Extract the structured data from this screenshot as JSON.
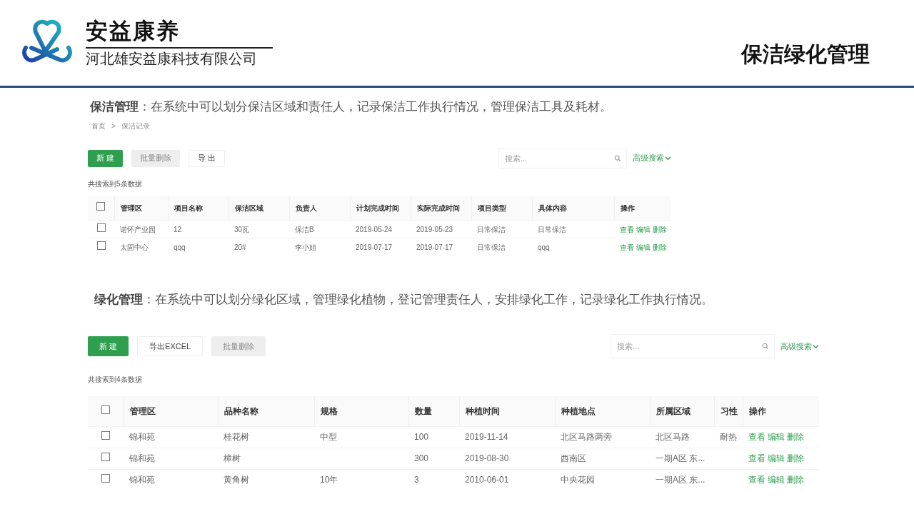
{
  "header": {
    "brand": "安益康养",
    "company": "河北雄安益康科技有限公司",
    "page_title": "保洁绿化管理"
  },
  "sections": [
    {
      "intro": "**保洁管理**：在系统中可以划分保洁区域和责任人，记录保洁工作执行情况，管理保洁工具及耗材。",
      "breadcrumb": [
        "首页",
        "保洁记录"
      ],
      "breadcrumb_sep": ">",
      "buttons": [
        {
          "label": "新 建",
          "kind": "primary",
          "disabled": false
        },
        {
          "label": "批量删除",
          "kind": "plain",
          "disabled": true
        },
        {
          "label": "导 出",
          "kind": "plain",
          "disabled": false
        }
      ],
      "search": {
        "placeholder": "搜索...",
        "advanced": "高级搜索"
      },
      "count": "共搜索到5条数据",
      "table": {
        "all_checked": false,
        "columns": [
          "管理区",
          "项目名称",
          "保洁区域",
          "负责人",
          "计划完成时间",
          "实际完成时间",
          "项目类型",
          "具体内容",
          "操作"
        ],
        "rows": [
          {
            "checked": false,
            "cells": [
              "诺怀产业园",
              "12",
              "30瓦",
              "保洁B",
              "2019-05-24",
              "2019-05-23",
              "日常保洁",
              "日常保洁"
            ],
            "actions": [
              "查看",
              "编辑",
              "删除"
            ]
          },
          {
            "checked": false,
            "cells": [
              "太固中心",
              "qqq",
              "20#",
              "李小姐",
              "2019-07-17",
              "2019-07-17",
              "日常保洁",
              "qqq"
            ],
            "actions": [
              "查看",
              "编辑",
              "删除"
            ]
          }
        ]
      }
    },
    {
      "intro": "**绿化管理**：在系统中可以划分绿化区域，管理绿化植物，登记管理责任人，安排绿化工作，记录绿化工作执行情况。",
      "buttons": [
        {
          "label": "新 建",
          "kind": "primary",
          "disabled": false
        },
        {
          "label": "导出EXCEL",
          "kind": "plain",
          "disabled": false
        },
        {
          "label": "批量删除",
          "kind": "plain",
          "disabled": true
        }
      ],
      "search": {
        "placeholder": "搜索...",
        "advanced": "高级搜索"
      },
      "count": "共搜索到4条数据",
      "table": {
        "all_checked": false,
        "columns": [
          "管理区",
          "品种名称",
          "规格",
          "数量",
          "种植时间",
          "种植地点",
          "所属区域",
          "习性",
          "操作"
        ],
        "rows": [
          {
            "checked": false,
            "cells": [
              "锦和苑",
              "桂花树",
              "中型",
              "100",
              "2019-11-14",
              "北区马路两旁",
              "北区马路",
              "耐热"
            ],
            "actions": [
              "查看",
              "编辑",
              "删除"
            ]
          },
          {
            "checked": false,
            "cells": [
              "锦和苑",
              "樟树",
              "",
              "300",
              "2019-08-30",
              "西南区",
              "一期A区 东...",
              ""
            ],
            "actions": [
              "查看",
              "编辑",
              "删除"
            ]
          },
          {
            "checked": false,
            "cells": [
              "锦和苑",
              "黄角树",
              "10年",
              "3",
              "2010-06-01",
              "中央花园",
              "一期A区 东...",
              ""
            ],
            "actions": [
              "查看",
              "编辑",
              "删除"
            ]
          }
        ]
      }
    }
  ]
}
